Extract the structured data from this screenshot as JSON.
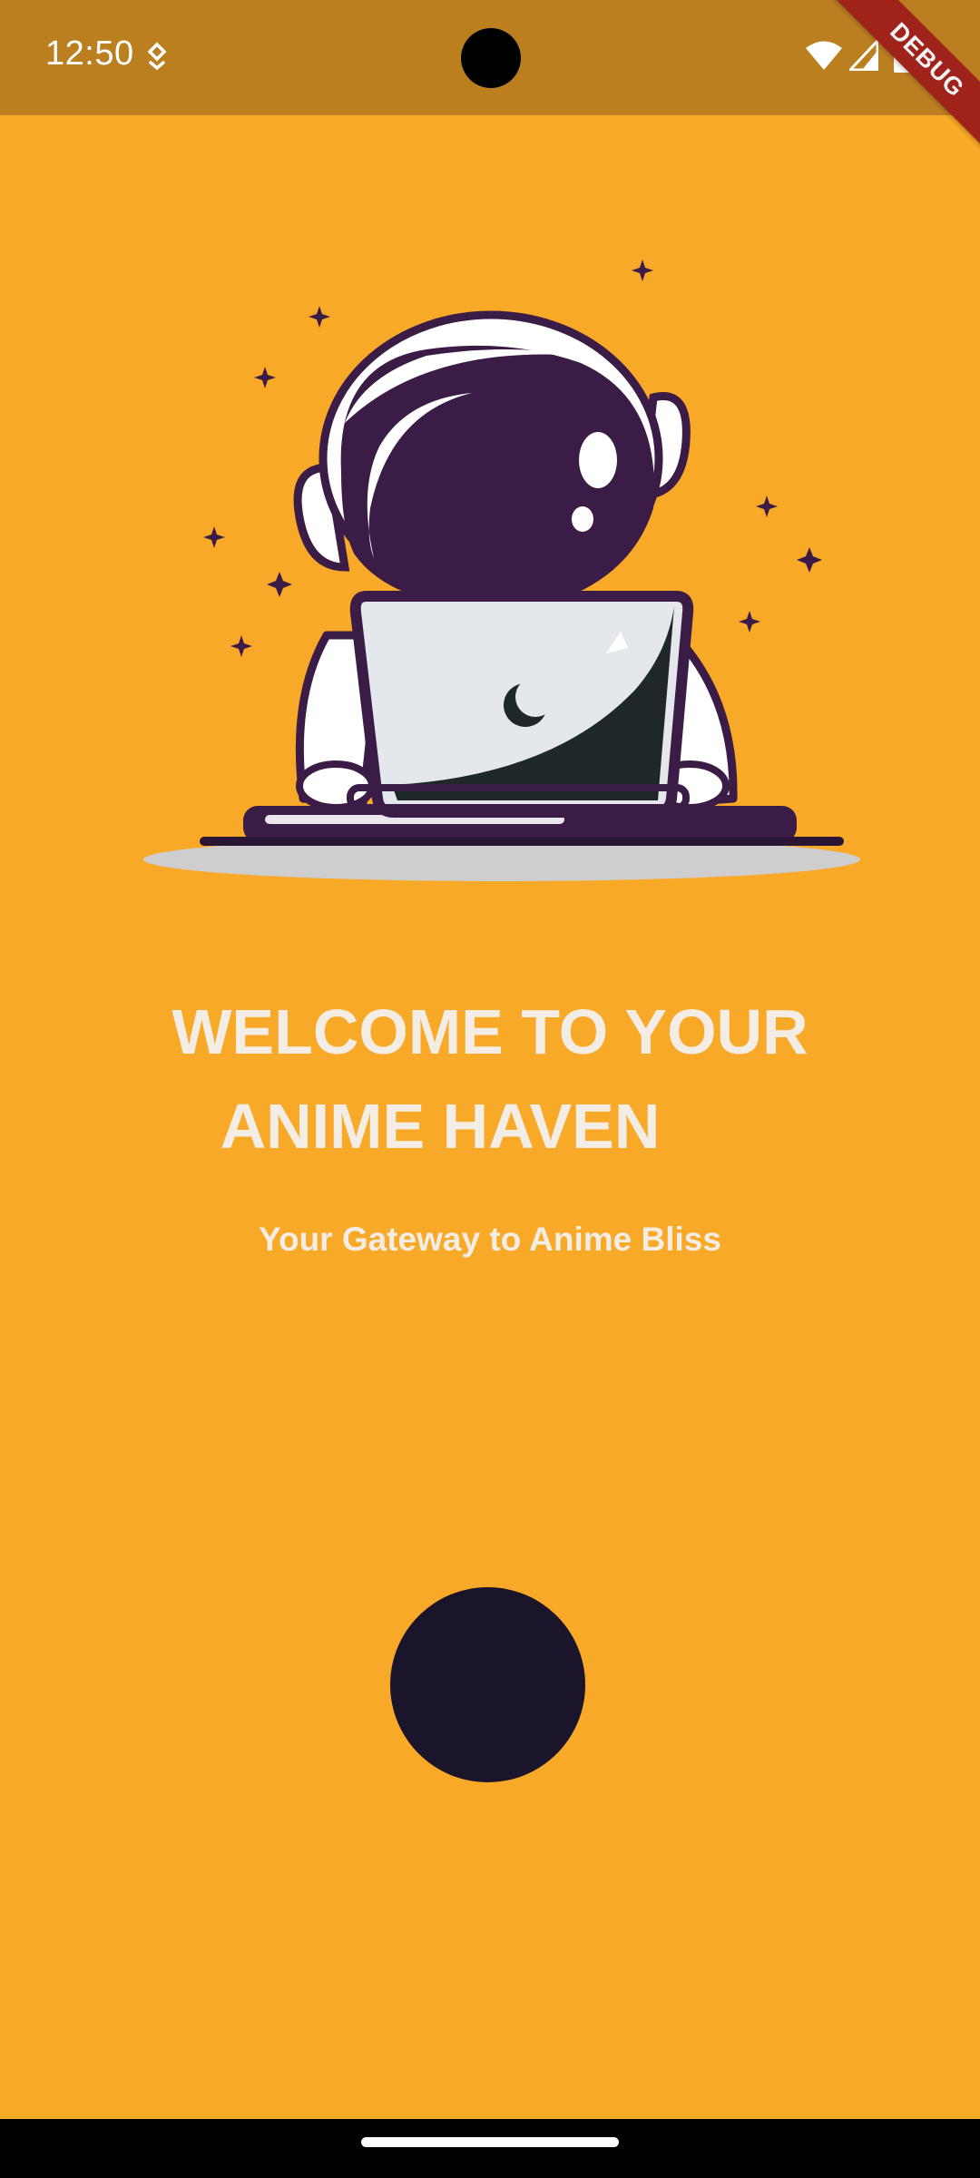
{
  "status_bar": {
    "time": "12:50",
    "icons": [
      "notification-icon",
      "wifi-icon",
      "signal-icon",
      "battery-icon"
    ]
  },
  "debug_banner": {
    "label": "DEBUG"
  },
  "welcome": {
    "title_line1": "WELCOME TO YOUR",
    "title_line2": "ANIME HAVEN",
    "subtitle": "Your Gateway to Anime Bliss"
  },
  "illustration": {
    "name": "astronaut-with-laptop-illustration"
  },
  "colors": {
    "background": "#F8A927",
    "status_bar": "#BC7F20",
    "text": "#F4EDE6",
    "button": "#1B152B",
    "illustration_purple": "#3A1C47",
    "debug_banner": "#A0231B"
  }
}
